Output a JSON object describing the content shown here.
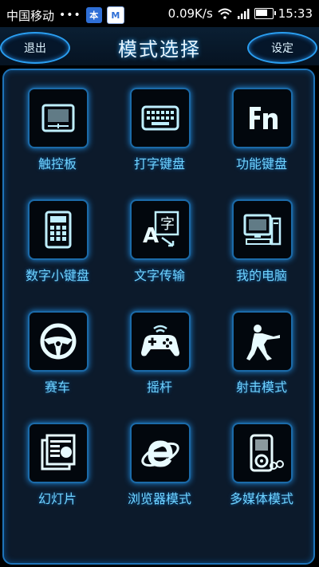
{
  "status_bar": {
    "carrier": "中国移动",
    "dots": "•••",
    "app_icon_1": "本",
    "app_icon_2": "M",
    "network_speed": "0.09K/s",
    "time": "15:33",
    "battery_level": 0.8
  },
  "header": {
    "back_label": "退出",
    "title": "模式选择",
    "settings_label": "设定"
  },
  "modes": [
    {
      "label": "触控板",
      "icon": "touchpad-icon"
    },
    {
      "label": "打字键盘",
      "icon": "keyboard-icon"
    },
    {
      "label": "功能键盘",
      "icon": "fn-key-icon"
    },
    {
      "label": "数字小键盘",
      "icon": "calculator-icon"
    },
    {
      "label": "文字传输",
      "icon": "text-transfer-icon"
    },
    {
      "label": "我的电脑",
      "icon": "computer-icon"
    },
    {
      "label": "赛车",
      "icon": "steering-wheel-icon"
    },
    {
      "label": "摇杆",
      "icon": "gamepad-icon"
    },
    {
      "label": "射击模式",
      "icon": "shooter-icon"
    },
    {
      "label": "幻灯片",
      "icon": "slides-icon"
    },
    {
      "label": "浏览器模式",
      "icon": "browser-icon"
    },
    {
      "label": "多媒体模式",
      "icon": "media-player-icon"
    }
  ],
  "colors": {
    "accent": "#2a9ef0",
    "label": "#6fd3ff",
    "panel": "#0c1a2b"
  }
}
